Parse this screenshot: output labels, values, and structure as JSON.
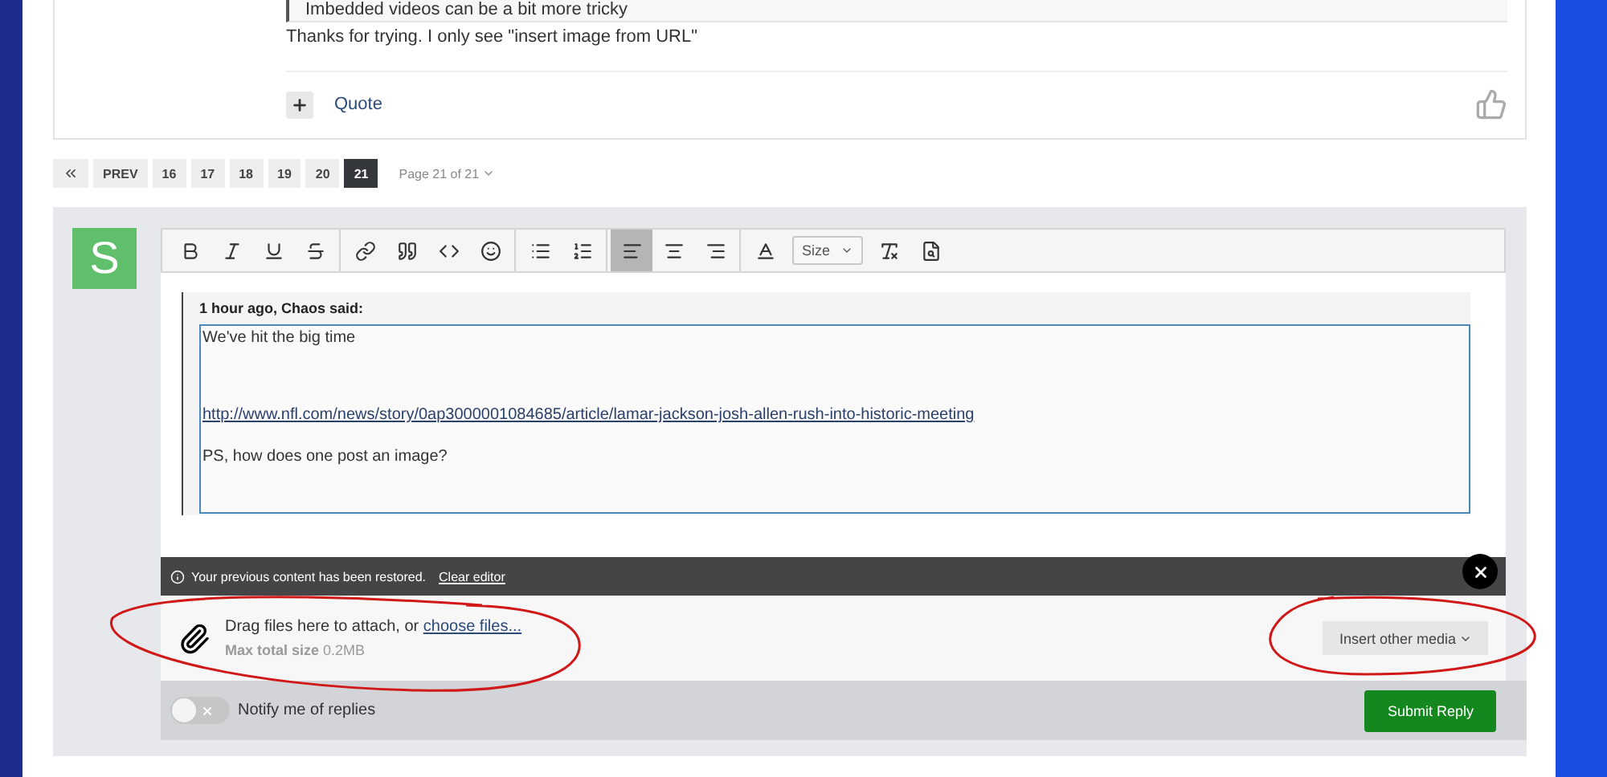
{
  "post": {
    "quote": "Imbedded videos can be a bit more tricky",
    "body": "Thanks for trying.  I only see \"insert image from URL\"",
    "quote_link": "Quote"
  },
  "pagination": {
    "prev": "PREV",
    "pages": [
      {
        "label": "16",
        "selected": false
      },
      {
        "label": "17",
        "selected": false
      },
      {
        "label": "18",
        "selected": false
      },
      {
        "label": "19",
        "selected": false
      },
      {
        "label": "20",
        "selected": false
      },
      {
        "label": "21",
        "selected": true
      }
    ],
    "page_menu": "Page 21 of 21"
  },
  "reply": {
    "avatar_letter": "S",
    "toolbar": {
      "buttons": [
        {
          "selected": false
        },
        {
          "selected": false
        },
        {
          "selected": false
        },
        {
          "selected": false
        },
        {
          "selected": false
        },
        {
          "selected": false
        },
        {
          "selected": false
        },
        {
          "selected": false
        },
        {
          "selected": false
        },
        {
          "selected": false
        },
        {
          "selected": true
        },
        {
          "selected": false
        },
        {
          "selected": false
        },
        {
          "selected": false
        },
        {
          "selected": false
        },
        {
          "selected": false
        }
      ],
      "size_label": "Size"
    },
    "quote_header": "1 hour ago, Chaos said:",
    "lines": [
      {
        "kind": "text",
        "text": "We've hit the big time"
      },
      {
        "kind": "blank"
      },
      {
        "kind": "link",
        "text": "http://www.nfl.com/news/story/0ap3000001084685/article/lamar-jackson-josh-allen-rush-into-historic-meeting"
      },
      {
        "kind": "text",
        "text": "PS, how does one post an image?"
      }
    ],
    "notice": {
      "text": "Your previous content has been restored.",
      "link": "Clear editor"
    },
    "attach": {
      "text": "Drag files here to attach, or",
      "link": "choose files...",
      "max_label": "Max total size",
      "max_value": "0.2MB"
    },
    "insert_media": "Insert other media",
    "notify": {
      "label": "Notify me of replies",
      "on": false
    },
    "submit": "Submit Reply"
  }
}
